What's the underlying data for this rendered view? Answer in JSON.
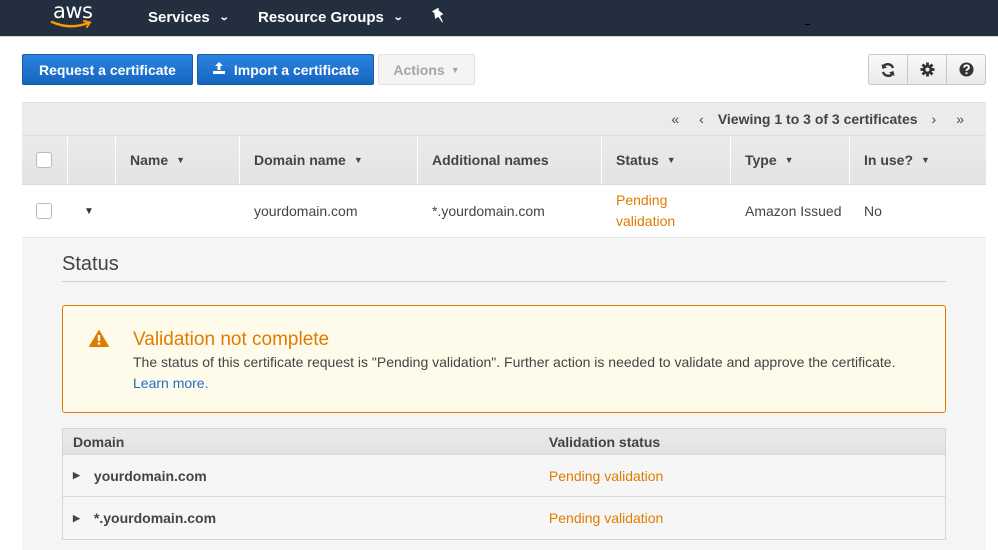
{
  "nav": {
    "logo": "aws",
    "services_label": "Services",
    "resource_groups_label": "Resource Groups",
    "pin_icon": "pushpin-icon"
  },
  "toolbar": {
    "request_label": "Request a certificate",
    "import_label": "Import a certificate",
    "actions_label": "Actions",
    "icons": [
      "refresh-icon",
      "gear-icon",
      "help-icon"
    ]
  },
  "colors": {
    "nav_bg": "#232f3e",
    "primary": "#1565c0",
    "warning": "#e07b00",
    "link": "#1f6ec8"
  },
  "pager": {
    "first": "«",
    "prev": "‹",
    "info": "Viewing 1 to 3 of 3 certificates",
    "next": "›",
    "last": "»"
  },
  "table": {
    "columns": [
      "Name",
      "Domain name",
      "Additional names",
      "Status",
      "Type",
      "In use?"
    ],
    "rows": [
      {
        "name": "",
        "domain": "yourdomain.com",
        "additional": "*.yourdomain.com",
        "status_line1": "Pending",
        "status_line2": "validation",
        "type": "Amazon Issued",
        "in_use": "No"
      }
    ]
  },
  "detail": {
    "title": "Status",
    "alert": {
      "title": "Validation not complete",
      "message": "The status of this certificate request is \"Pending validation\". Further action is needed to validate and approve the certificate.",
      "link": "Learn more."
    },
    "validation_table": {
      "columns": [
        "Domain",
        "Validation status"
      ],
      "rows": [
        {
          "domain": "yourdomain.com",
          "status": "Pending validation"
        },
        {
          "domain": "*.yourdomain.com",
          "status": "Pending validation"
        }
      ]
    }
  }
}
